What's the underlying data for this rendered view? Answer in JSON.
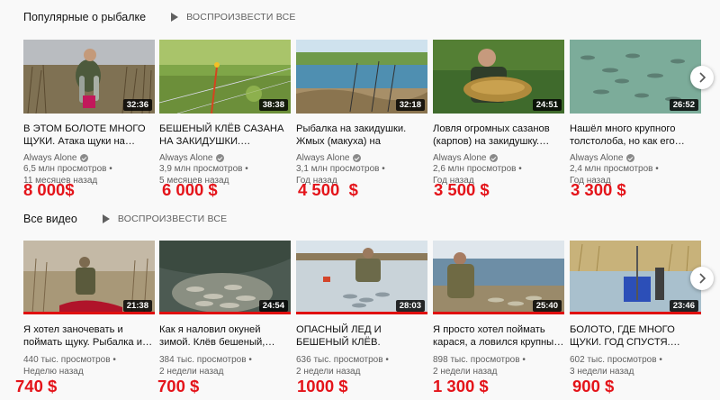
{
  "shelves": [
    {
      "title": "Популярные о рыбалке",
      "play_all": "ВОСПРОИЗВЕСТИ ВСЕ",
      "videos": [
        {
          "title": "В ЭТОМ БОЛОТЕ МНОГО ЩУКИ. Атака щуки на…",
          "channel": "Always Alone",
          "views": "6,5 млн просмотров •",
          "age": "11 месяцев назад",
          "duration": "32:36",
          "price": "8 000$"
        },
        {
          "title": "БЕШЕНЫЙ КЛЁВ САЗАНА НА ЗАКИДУШКИ.…",
          "channel": "Always Alone",
          "views": "3,9 млн просмотров •",
          "age": "5 месяцев назад",
          "duration": "38:38",
          "price": "6 000 $"
        },
        {
          "title": "Рыбалка на закидушки. Жмых (макуха) на сазана,…",
          "channel": "Always Alone",
          "views": "3,1 млн просмотров •",
          "age": "Год назад",
          "duration": "32:18",
          "price": "4 500  $"
        },
        {
          "title": "Ловля огромных сазанов (карпов) на закидушку.…",
          "channel": "Always Alone",
          "views": "2,6 млн просмотров •",
          "age": "Год назад",
          "duration": "24:51",
          "price": "3 500 $"
        },
        {
          "title": "Нашёл много крупного толстолоба, но как его…",
          "channel": "Always Alone",
          "views": "2,4 млн просмотров •",
          "age": "Год назад",
          "duration": "26:52",
          "price": "3 300 $"
        }
      ]
    },
    {
      "title": "Все видео",
      "play_all": "ВОСПРОИЗВЕСТИ ВСЕ",
      "videos": [
        {
          "title": "Я хотел заночевать и поймать щуку. Рыбалка и…",
          "views": "440 тыс. просмотров •",
          "age": "Неделю назад",
          "duration": "21:38",
          "price": "740 $"
        },
        {
          "title": "Как я наловил окуней зимой. Клёв бешеный,…",
          "views": "384 тыс. просмотров •",
          "age": "2 недели назад",
          "duration": "24:54",
          "price": "700 $"
        },
        {
          "title": "ОПАСНЫЙ ЛЕД И БЕШЕНЫЙ КЛЁВ. Зимняя…",
          "views": "636 тыс. просмотров •",
          "age": "2 недели назад",
          "duration": "28:03",
          "price": "1000 $"
        },
        {
          "title": "Я просто хотел поймать карася, а ловился крупны…",
          "views": "898 тыс. просмотров •",
          "age": "2 недели назад",
          "duration": "25:40",
          "price": "1 300 $"
        },
        {
          "title": "БОЛОТО, ГДЕ МНОГО ЩУКИ. ГОД СПУСТЯ.…",
          "views": "602 тыс. просмотров •",
          "age": "3 недели назад",
          "duration": "23:46",
          "price": "900 $"
        }
      ]
    }
  ],
  "icons": {
    "play_all": "play-icon",
    "verified": "verified-check-icon",
    "next": "chevron-right-icon"
  },
  "colors": {
    "price": "#e4141a",
    "watched_bar": "#e01010",
    "meta": "#606060"
  }
}
